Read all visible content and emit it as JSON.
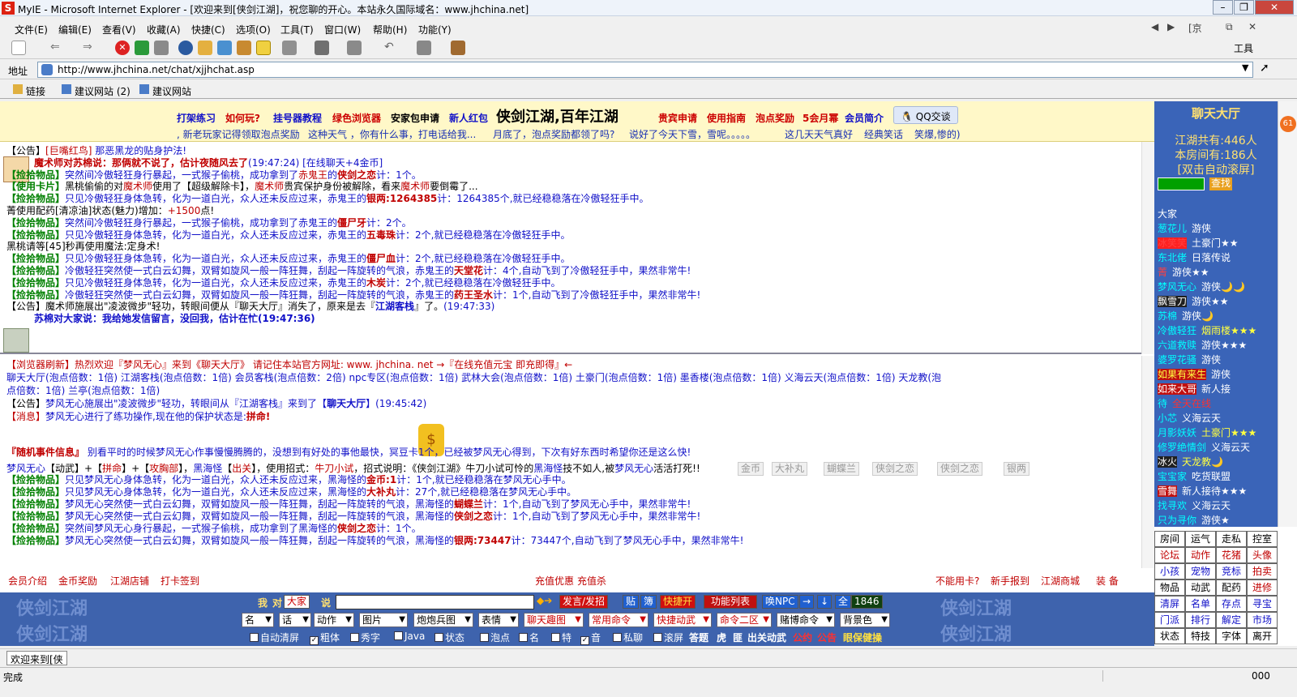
{
  "window": {
    "title": "MyIE - Microsoft Internet Explorer - [欢迎来到[侠剑江湖]，祝您聊的开心。本站永久国际域名：www.jhchina.net]",
    "nav_indicator": "[京"
  },
  "menu": [
    "文件(E)",
    "编辑(E)",
    "查看(V)",
    "收藏(A)",
    "快捷(C)",
    "选项(O)",
    "工具(T)",
    "窗口(W)",
    "帮助(H)",
    "功能(Y)"
  ],
  "toolbar": {
    "tools_label": "工具"
  },
  "address": {
    "label": "地址",
    "url": "http://www.jhchina.net/chat/xjjhchat.asp"
  },
  "links_bar": {
    "links_label": "链接",
    "items": [
      "建议网站 (2)",
      "建议网站"
    ]
  },
  "banner": {
    "links": [
      "打架练习",
      "如何玩?",
      "挂号器教程",
      "绿色浏览器",
      "安家包申请",
      "新人红包",
      "侠剑江湖,百年江湖",
      "贵宾申请",
      "使用指南",
      "泡点奖励",
      "5会月幂",
      "会员简介"
    ],
    "qq": "QQ交谈",
    "marquee": [
      ", 新老玩家记得领取泡点奖励",
      "这种天气 ，你有什么事，打电话给我...",
      "月底了，泡点奖励都领了吗?",
      "说好了今天下雪，雪呢。。。。。",
      "这几天天气真好",
      "经典笑话",
      "笑爆,惨的)"
    ]
  },
  "chat_top": [
    {
      "parts": [
        [
          "【公告】",
          ""
        ],
        [
          "[巨嘴红鸟]",
          "r"
        ],
        [
          "       那恶黑龙的贴身护法!",
          "b"
        ]
      ]
    },
    {
      "parts": [
        [
          "魔术师对苏棉说：那俩就不说了，估计夜随风去了",
          "rb"
        ],
        [
          "(19:47:24)",
          "b"
        ],
        [
          "  [在线聊天+4金币]",
          "b"
        ]
      ]
    },
    {
      "parts": [
        [
          "【捡拾物品】",
          "g"
        ],
        [
          "突然间冷傲轻狂身行暴起，一式猴子偷桃，成功拿到了",
          "b"
        ],
        [
          "赤鬼王",
          "r"
        ],
        [
          "的",
          "b"
        ],
        [
          "侠剑之恋",
          "rb"
        ],
        [
          "计：1个。",
          "b"
        ]
      ]
    },
    {
      "parts": [
        [
          "【使用卡片】",
          "g"
        ],
        [
          "黑桃偷偷的对",
          ""
        ],
        [
          "魔术师",
          "r"
        ],
        [
          "使用了【超级解除卡】，",
          ""
        ],
        [
          "魔术师",
          "r"
        ],
        [
          "贵宾保护身份被解除，看来",
          ""
        ],
        [
          "魔术师",
          "r"
        ],
        [
          "要倒霉了...",
          ""
        ]
      ]
    },
    {
      "parts": [
        [
          "【捡拾物品】",
          "g"
        ],
        [
          "只见冷傲轻狂身体急转，化为一道白光，众人还未反应过来，赤鬼王的",
          "b"
        ],
        [
          "银两:1264385",
          "rb"
        ],
        [
          "计：1264385个,就已经稳稳落在冷傲轻狂手中。",
          "b"
        ]
      ]
    },
    {
      "parts": [
        [
          "菁使用配药[清凉油]状态(魅力)增加：",
          ""
        ],
        [
          "+1500",
          "r"
        ],
        [
          "点!",
          ""
        ]
      ]
    },
    {
      "parts": [
        [
          "【捡拾物品】",
          "g"
        ],
        [
          "突然间冷傲轻狂身行暴起，一式猴子偷桃，成功拿到了赤鬼王的",
          "b"
        ],
        [
          "僵尸牙",
          "rb"
        ],
        [
          "计：2个。",
          "b"
        ]
      ]
    },
    {
      "parts": [
        [
          "【捡拾物品】",
          "g"
        ],
        [
          "只见冷傲轻狂身体急转，化为一道白光，众人还未反应过来，赤鬼王的",
          "b"
        ],
        [
          "五毒珠",
          "rb"
        ],
        [
          "计：2个,就已经稳稳落在冷傲轻狂手中。",
          "b"
        ]
      ]
    },
    {
      "parts": [
        [
          "黑桃请等[45]秒再使用魔法:定身术!",
          ""
        ]
      ]
    },
    {
      "parts": [
        [
          "【捡拾物品】",
          "g"
        ],
        [
          "只见冷傲轻狂身体急转，化为一道白光，众人还未反应过来，赤鬼王的",
          "b"
        ],
        [
          "僵尸血",
          "rb"
        ],
        [
          "计：2个,就已经稳稳落在冷傲轻狂手中。",
          "b"
        ]
      ]
    },
    {
      "parts": [
        [
          "【捡拾物品】",
          "g"
        ],
        [
          "冷傲轻狂突然使一式白云幻舞，双臂如旋风一般一阵狂舞，刮起一阵旋转的气浪，赤鬼王的",
          "b"
        ],
        [
          "天堂花",
          "rb"
        ],
        [
          "计：4个,自动飞到了冷傲轻狂手中，果然非常牛!",
          "b"
        ]
      ]
    },
    {
      "parts": [
        [
          "【捡拾物品】",
          "g"
        ],
        [
          "只见冷傲轻狂身体急转，化为一道白光，众人还未反应过来，赤鬼王的",
          "b"
        ],
        [
          "木炭",
          "rb"
        ],
        [
          "计：2个,就已经稳稳落在冷傲轻狂手中。",
          "b"
        ]
      ]
    },
    {
      "parts": [
        [
          "【捡拾物品】",
          "g"
        ],
        [
          "冷傲轻狂突然使一式白云幻舞，双臂如旋风一般一阵狂舞，刮起一阵旋转的气浪，赤鬼王的",
          "b"
        ],
        [
          "药王圣水",
          "rb"
        ],
        [
          "计：1个,自动飞到了冷傲轻狂手中，果然非常牛!",
          "b"
        ]
      ]
    },
    {
      "parts": [
        [
          "【公告】魔术师施展出\"凌波微步\"轻功，转眼间便从『聊天大厅』消失了，原来是去『",
          ""
        ],
        [
          "江湖客栈",
          "bb"
        ],
        [
          "』了。",
          ""
        ],
        [
          "(19:47:33)",
          "b"
        ]
      ]
    },
    {
      "parts": [
        [
          "苏棉对大家说：我给她发信留言，没回我，估计在忙(19:47:36)",
          "bb"
        ]
      ]
    }
  ],
  "chat_bottom": [
    {
      "parts": [
        [
          "【浏览器刷新】热烈欢迎『梦风无心』来到《聊天大厅》 请记住本站官方网址: www. jhchina. net  →『在线充值元宝 即充即得』←",
          "r"
        ]
      ]
    },
    {
      "parts": [
        [
          "聊天大厅(泡点倍数：1倍)  江湖客栈(泡点倍数：1倍)  会员客栈(泡点倍数：2倍)  npc专区(泡点倍数：1倍)  武林大会(泡点倍数：1倍)  土豪门(泡点倍数：1倍)  墨香楼(泡点倍数：1倍)  义海云天(泡点倍数：1倍)  天龙教(泡",
          "b"
        ]
      ]
    },
    {
      "parts": [
        [
          "点倍数：1倍)  兰亭(泡点倍数：1倍)",
          "b"
        ]
      ]
    },
    {
      "parts": [
        [
          "【公告】",
          ""
        ],
        [
          "梦风无心施展出\"凌波微步\"轻功，转眼间从『江湖客栈』来到了【",
          "b"
        ],
        [
          "聊天大厅",
          "bb"
        ],
        [
          "】",
          "b"
        ],
        [
          "(19:45:42)",
          "b"
        ]
      ]
    },
    {
      "parts": [
        [
          "【消息】",
          "r"
        ],
        [
          "梦风无心进行了练功操作,现在他的保护状态是:",
          "b"
        ],
        [
          "拼命!",
          "rb"
        ]
      ]
    },
    {
      "parts": [
        [
          "『随机事件信息』",
          "rb"
        ],
        [
          "  别看平时的时候梦风无心作事慢慢腾腾的，没想到有好处的事他最快，",
          "b"
        ],
        [
          "冥豆卡",
          "b"
        ],
        [
          "1个，已经被梦风无心得到，下次有好东西时希望你还是这么快!",
          "b"
        ]
      ]
    },
    {
      "parts": [
        [
          "梦风无心",
          "b"
        ],
        [
          "【动武】+【",
          ""
        ],
        [
          "拼命",
          "r"
        ],
        [
          "】+【",
          ""
        ],
        [
          "攻胸部",
          "r"
        ],
        [
          "】，",
          ""
        ],
        [
          "黑海怪",
          "b"
        ],
        [
          "【",
          ""
        ],
        [
          "出关",
          "r"
        ],
        [
          "】，使用招式：",
          ""
        ],
        [
          "牛刀小试",
          "r"
        ],
        [
          "，招式说明：《侠剑江湖》牛刀小试可怜的",
          ""
        ],
        [
          "黑海怪",
          "b"
        ],
        [
          "技不如人,被",
          ""
        ],
        [
          "梦风无心",
          "b"
        ],
        [
          "活活打死!!",
          ""
        ]
      ]
    },
    {
      "parts": [
        [
          "【捡拾物品】",
          "g"
        ],
        [
          "只见梦风无心身体急转，化为一道白光，众人还未反应过来，黑海怪的",
          "b"
        ],
        [
          "金币:1",
          "rb"
        ],
        [
          "计：1个,就已经稳稳落在梦风无心手中。",
          "b"
        ]
      ]
    },
    {
      "parts": [
        [
          "【捡拾物品】",
          "g"
        ],
        [
          "只见梦风无心身体急转，化为一道白光，众人还未反应过来，黑海怪的",
          "b"
        ],
        [
          "大补丸",
          "rb"
        ],
        [
          "计：27个,就已经稳稳落在梦风无心手中。",
          "b"
        ]
      ]
    },
    {
      "parts": [
        [
          "【捡拾物品】",
          "g"
        ],
        [
          "梦风无心突然使一式白云幻舞，双臂如旋风一般一阵狂舞，刮起一阵旋转的气浪，黑海怪的",
          "b"
        ],
        [
          "蝴蝶兰",
          "rb"
        ],
        [
          "计：1个,自动飞到了梦风无心手中，果然非常牛!",
          "b"
        ]
      ]
    },
    {
      "parts": [
        [
          "【捡拾物品】",
          "g"
        ],
        [
          "梦风无心突然使一式白云幻舞，双臂如旋风一般一阵狂舞，刮起一阵旋转的气浪，黑海怪的",
          "b"
        ],
        [
          "侠剑之恋",
          "rb"
        ],
        [
          "计：1个,自动飞到了梦风无心手中，果然非常牛!",
          "b"
        ]
      ]
    },
    {
      "parts": [
        [
          "【捡拾物品】",
          "g"
        ],
        [
          "突然间梦风无心身行暴起，一式猴子偷桃，成功拿到了黑海怪的",
          "b"
        ],
        [
          "侠剑之恋",
          "rb"
        ],
        [
          "计：1个。",
          "b"
        ]
      ]
    },
    {
      "parts": [
        [
          "【捡拾物品】",
          "g"
        ],
        [
          "梦风无心突然使一式白云幻舞，双臂如旋风一般一阵狂舞，刮起一阵旋转的气浪，黑海怪的",
          "b"
        ],
        [
          "银两:73447",
          "rb"
        ],
        [
          "计：73447个,自动飞到了梦风无心手中，果然非常牛!",
          "b"
        ]
      ]
    }
  ],
  "loot_buttons": [
    "金币",
    "大补丸",
    "蝴蝶兰",
    "侠剑之恋",
    "侠剑之恋",
    "银两"
  ],
  "footer_links": {
    "left": [
      "会员介绍",
      "金币奖励",
      "江湖店铺",
      "打卡签到"
    ],
    "center": [
      "充值优惠",
      "充值杀"
    ],
    "right": [
      "不能用卡?",
      "新手报到",
      "江湖商城",
      "装 备"
    ]
  },
  "controls": {
    "i_label": "我",
    "to_label": "对",
    "to_value": "大家",
    "say_label": "说",
    "send": "发言/发招",
    "tie": "贴",
    "ad": "簿",
    "quick": "快捷开",
    "funcs": "功能列表",
    "npc": "唤NPC",
    "all": "全",
    "count": "1846",
    "selects": [
      "名",
      "话",
      "动作",
      "图片",
      "炮炮兵图",
      "表情",
      "聊天趣图",
      "常用命令",
      "快捷动武",
      "命令二区",
      "赌博命令",
      "背景色"
    ],
    "checks": [
      {
        "label": "自动清屏",
        "on": false
      },
      {
        "label": "粗体",
        "on": true
      },
      {
        "label": "秀字",
        "on": false
      },
      {
        "label": "Java",
        "on": false
      },
      {
        "label": "状态",
        "on": false
      },
      {
        "label": "泡点",
        "on": false
      },
      {
        "label": "名",
        "on": false
      },
      {
        "label": "特",
        "on": false
      },
      {
        "label": "音",
        "on": true
      },
      {
        "label": "私聊",
        "on": false
      },
      {
        "label": "滚屏",
        "on": false
      }
    ],
    "tail": [
      "答题",
      "虎",
      "匪",
      "出关动武"
    ],
    "tail_red": [
      "公约",
      "公告"
    ],
    "tail_yellow": "眼保健操",
    "watermark": "侠剑江湖"
  },
  "hall": {
    "title": "聊天大厅",
    "total": "江湖共有:446人",
    "room": "本房间有:186人",
    "autoscroll": "[双击自动滚屏]",
    "find": "查找",
    "badge": "61",
    "users": [
      {
        "name": "大家",
        "title": "",
        "nc": "#ffffff",
        "tc": "#ffffff"
      },
      {
        "name": "葱花儿",
        "title": "游侠",
        "nc": "#00ffff",
        "tc": "#ffffff"
      },
      {
        "name": "冰笑笑",
        "title": "土豪门★★",
        "nc": "#ff4040",
        "tc": "#ffffff",
        "hl": "#ff2020"
      },
      {
        "name": "东北佬",
        "title": "日落传说",
        "nc": "#00ffff",
        "tc": "#ffffff"
      },
      {
        "name": "菁",
        "title": "游侠★★",
        "nc": "#ff4040",
        "tc": "#ffffff"
      },
      {
        "name": "梦风无心",
        "title": "游侠🌙🌙",
        "nc": "#00ffff",
        "tc": "#ffffff"
      },
      {
        "name": "飘雪刀",
        "title": "游侠★★",
        "nc": "#ffffff",
        "tc": "#ffffff",
        "hl": "#202020"
      },
      {
        "name": "苏棉",
        "title": "游侠🌙",
        "nc": "#00ffff",
        "tc": "#ffffff"
      },
      {
        "name": "冷傲轻狂",
        "title": "烟雨楼★★★",
        "nc": "#00ffff",
        "tc": "#ffff40"
      },
      {
        "name": "六道救赎",
        "title": "游侠★★★",
        "nc": "#00ffff",
        "tc": "#ffffff"
      },
      {
        "name": "婆罗花骚",
        "title": "游侠",
        "nc": "#00ffff",
        "tc": "#ffffff"
      },
      {
        "name": "如果有来生",
        "title": "游侠",
        "nc": "#ffff40",
        "tc": "#ffffff",
        "hl": "#c01010"
      },
      {
        "name": "如来大哥",
        "title": "新人接",
        "nc": "#ffffff",
        "tc": "#ffffff",
        "hl": "#c01010"
      },
      {
        "name": "待",
        "title": "全天在线",
        "nc": "#00ffff",
        "tc": "#ff3030"
      },
      {
        "name": "小芯",
        "title": "义海云天",
        "nc": "#00ffff",
        "tc": "#ffffff"
      },
      {
        "name": "月影妖妖",
        "title": "土豪门★★★",
        "nc": "#00ffff",
        "tc": "#ffff40"
      },
      {
        "name": "修罗绝情剑",
        "title": "义海云天",
        "nc": "#00ffff",
        "tc": "#ffffff"
      },
      {
        "name": "冰火",
        "title": "天龙教🌙",
        "nc": "#ffffff",
        "tc": "#ffff40",
        "hl": "#202020"
      },
      {
        "name": "宝宝家",
        "title": "吃货联盟",
        "nc": "#00ffff",
        "tc": "#ffffff"
      },
      {
        "name": "雪舞",
        "title": "新人接待★★★",
        "nc": "#ffffff",
        "tc": "#ffffff",
        "hl": "#c01010"
      },
      {
        "name": "找寻欢",
        "title": "义海云天",
        "nc": "#00ffff",
        "tc": "#ffffff"
      },
      {
        "name": "只为寻你",
        "title": "游侠★",
        "nc": "#00ffff",
        "tc": "#ffffff"
      }
    ]
  },
  "grid": [
    [
      "房间",
      "运气",
      "走私",
      "控室"
    ],
    [
      "论坛",
      "动作",
      "花猪",
      "头像"
    ],
    [
      "小孩",
      "宠物",
      "竞标",
      "拍卖"
    ],
    [
      "物品",
      "动武",
      "配药",
      "进修"
    ],
    [
      "清屏",
      "名单",
      "存点",
      "寻宝"
    ],
    [
      "门派",
      "排行",
      "解定",
      "市场"
    ],
    [
      "状态",
      "特技",
      "字体",
      "离开"
    ]
  ],
  "grid_colors": [
    [
      "#000000",
      "#000000",
      "#000000",
      "#000000"
    ],
    [
      "#c00000",
      "#c00000",
      "#c00000",
      "#c00000"
    ],
    [
      "#1010c8",
      "#1010c8",
      "#1010c8",
      "#c00000"
    ],
    [
      "#000000",
      "#000000",
      "#000000",
      "#c00000"
    ],
    [
      "#1010c8",
      "#1010c8",
      "#1010c8",
      "#1010c8"
    ],
    [
      "#1010c8",
      "#1010c8",
      "#1010c8",
      "#1010c8"
    ],
    [
      "#000000",
      "#000000",
      "#000000",
      "#000000"
    ]
  ],
  "tabs": {
    "active": "欢迎来到[侠"
  },
  "status": {
    "text": "完成",
    "right": "000"
  }
}
